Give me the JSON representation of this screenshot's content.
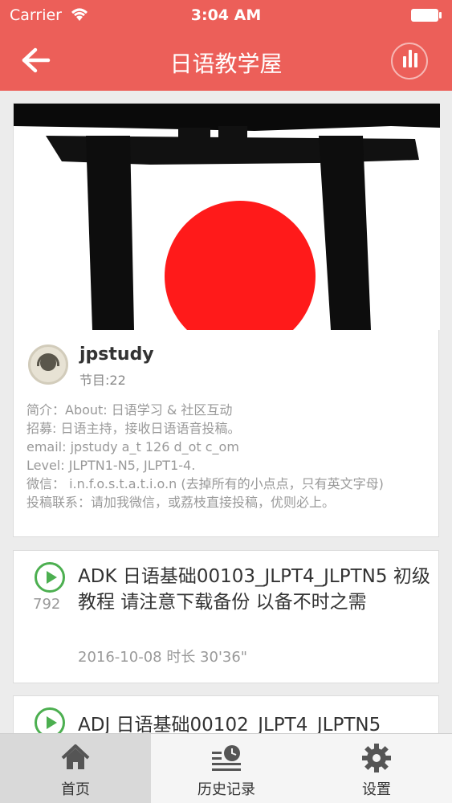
{
  "status_bar": {
    "carrier": "Carrier",
    "time": "3:04 AM"
  },
  "nav": {
    "title": "日语教学屋"
  },
  "colors": {
    "theme": "#ec5f59",
    "play": "#4caf50",
    "sun": "#ff1a1a"
  },
  "icons": {
    "back": "back-arrow-icon",
    "stats": "bar-chart-icon",
    "home": "home-icon",
    "history": "history-icon",
    "settings": "gear-icon"
  },
  "profile": {
    "name": "jpstudy",
    "episodes": "节目:22",
    "description": [
      "简介：About: 日语学习 & 社区互动",
      "招募: 日语主持，接收日语语音投稿。",
      "email: jpstudy a_t 126 d_ot c_om",
      "Level: JLPTN1-N5, JLPT1-4.",
      "微信： i.n.f.o.s.t.a.t.i.o.n (去掉所有的小点点，只有英文字母)",
      "投稿联系：请加我微信，或荔枝直接投稿，优则必上。"
    ]
  },
  "episodes": [
    {
      "count": "792",
      "title": "ADK 日语基础00103_JLPT4_JLPTN5 初级教程 请注意下载备份 以备不时之需",
      "meta": "2016-10-08  时长 30'36\""
    },
    {
      "title": "ADJ 日语基础00102_JLPT4_JLPTN5"
    }
  ],
  "tabs": [
    {
      "label": "首页",
      "active": true
    },
    {
      "label": "历史记录",
      "active": false
    },
    {
      "label": "设置",
      "active": false
    }
  ]
}
